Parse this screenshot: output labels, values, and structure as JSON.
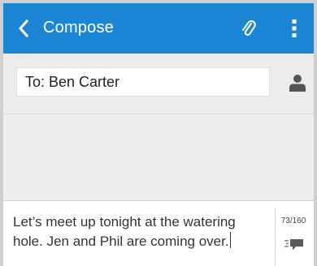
{
  "app_bar": {
    "title": "Compose",
    "back_icon": "chevron-left-icon",
    "attach_icon": "paperclip-icon",
    "menu_icon": "more-vertical-icon",
    "color": "#1d86d4"
  },
  "recipient": {
    "value": "To: Ben Carter",
    "contact_icon": "person-icon"
  },
  "compose": {
    "message": "Let’s meet up tonight at the watering\nhole. Jen and Phil are coming over.",
    "char_count": "73/160",
    "send_icon": "send-message-icon"
  }
}
